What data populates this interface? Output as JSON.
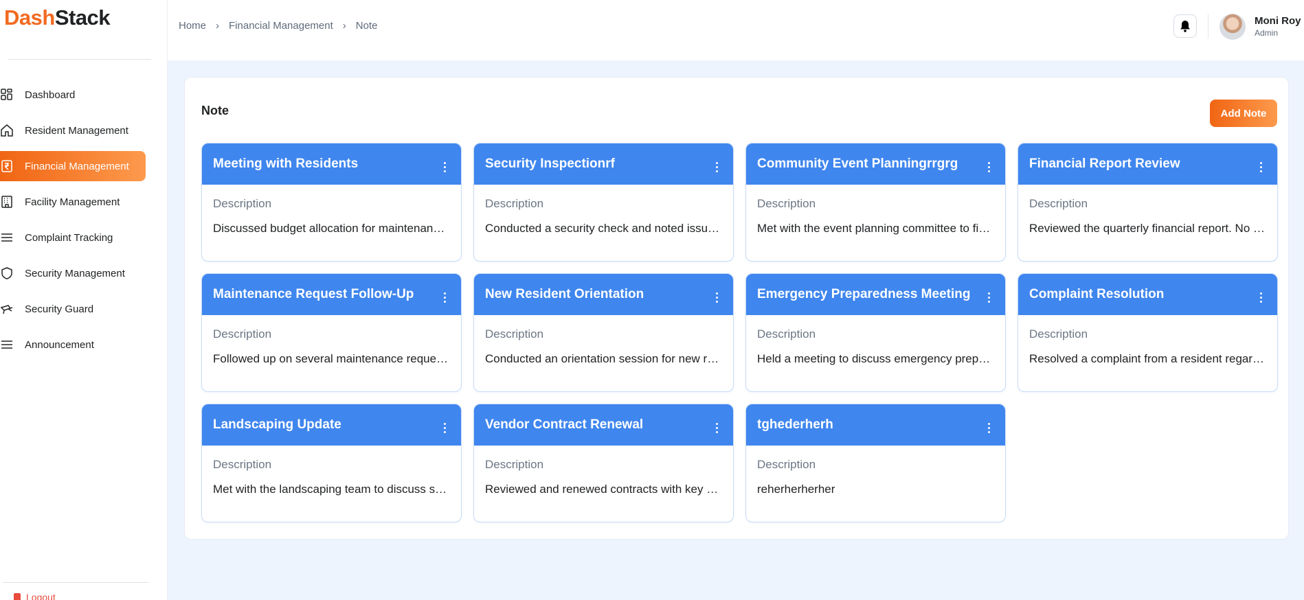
{
  "app": {
    "logo_part1": "Dash",
    "logo_part2": "Stack"
  },
  "sidebar": {
    "items": [
      {
        "label": "Dashboard",
        "icon": "dashboard-icon",
        "active": false
      },
      {
        "label": "Resident Management",
        "icon": "home-icon",
        "active": false
      },
      {
        "label": "Financial Management",
        "icon": "receipt-icon",
        "active": true
      },
      {
        "label": "Facility Management",
        "icon": "building-icon",
        "active": false
      },
      {
        "label": "Complaint Tracking",
        "icon": "list-icon",
        "active": false
      },
      {
        "label": "Security Management",
        "icon": "shield-icon",
        "active": false
      },
      {
        "label": "Security Guard",
        "icon": "guard-icon",
        "active": false
      },
      {
        "label": "Announcement",
        "icon": "list-icon",
        "active": false
      }
    ],
    "logout_label": "Logout"
  },
  "header": {
    "breadcrumb": [
      "Home",
      "Financial Management",
      "Note"
    ],
    "user_name": "Moni Roy",
    "user_role": "Admin"
  },
  "main": {
    "title": "Note",
    "add_button": "Add Note",
    "notes": [
      {
        "title": "Meeting with Residents",
        "label": "Description",
        "text": "Discussed budget allocation for maintenance and upcoming repairs."
      },
      {
        "title": "Security Inspectionrf",
        "label": "Description",
        "text": "Conducted a security check and noted issues with gates."
      },
      {
        "title": "Community Event Planningrrgrg",
        "label": "Description",
        "text": "Met with the event planning committee to finalize details."
      },
      {
        "title": "Financial Report Review",
        "label": "Description",
        "text": "Reviewed the quarterly financial report. No discrepancies."
      },
      {
        "title": "Maintenance Request Follow-Up",
        "label": "Description",
        "text": "Followed up on several maintenance requests from residents."
      },
      {
        "title": "New Resident Orientation",
        "label": "Description",
        "text": "Conducted an orientation session for new residents."
      },
      {
        "title": "Emergency Preparedness Meeting",
        "label": "Description",
        "text": "Held a meeting to discuss emergency preparedness plans."
      },
      {
        "title": "Complaint Resolution",
        "label": "Description",
        "text": "Resolved a complaint from a resident regarding noise."
      },
      {
        "title": "Landscaping Update",
        "label": "Description",
        "text": "Met with the landscaping team to discuss seasonal changes."
      },
      {
        "title": "Vendor Contract Renewal",
        "label": "Description",
        "text": "Reviewed and renewed contracts with key vendors."
      },
      {
        "title": "tghederherh",
        "label": "Description",
        "text": "reherherherher"
      }
    ]
  },
  "colors": {
    "accent": "#f06513",
    "card_header": "#3f86ee",
    "background": "#eef4fd"
  }
}
